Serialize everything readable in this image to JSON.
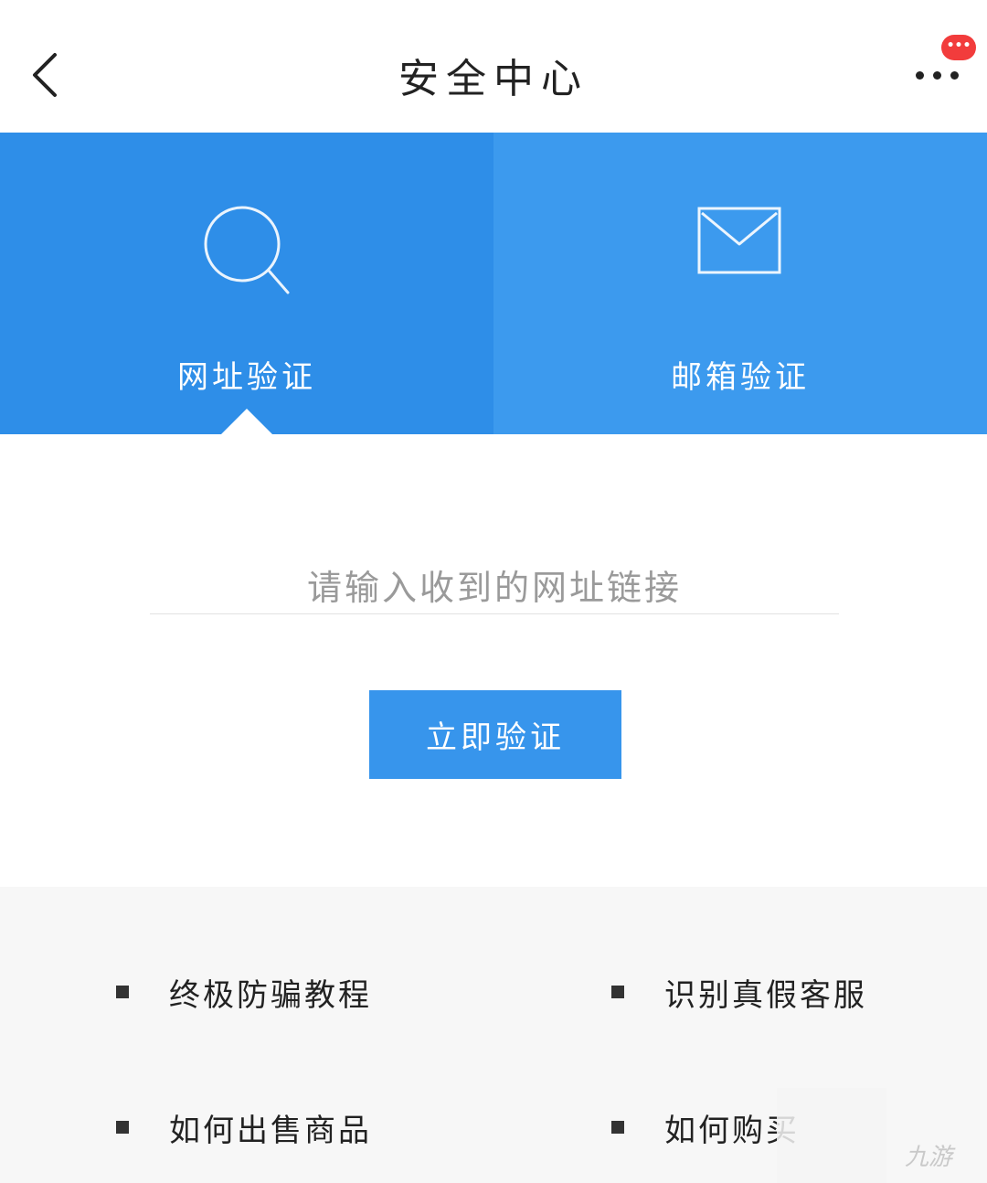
{
  "header": {
    "title": "安全中心",
    "back_icon": "chevron-left-icon",
    "more_icon": "more-dots-icon",
    "badge_text": "•••"
  },
  "tabs": [
    {
      "label": "网址验证",
      "icon": "search-icon",
      "active": true
    },
    {
      "label": "邮箱验证",
      "icon": "mail-icon",
      "active": false
    }
  ],
  "form": {
    "url_placeholder": "请输入收到的网址链接",
    "url_value": "",
    "verify_button": "立即验证"
  },
  "links": [
    {
      "label": "终极防骗教程"
    },
    {
      "label": "识别真假客服"
    },
    {
      "label": "如何出售商品"
    },
    {
      "label": "如何购买"
    }
  ],
  "watermark": "九游",
  "colors": {
    "primary": "#2e8ee8",
    "secondary_tab": "#3c9aee",
    "button": "#3795ec",
    "badge": "#f23c3c"
  }
}
